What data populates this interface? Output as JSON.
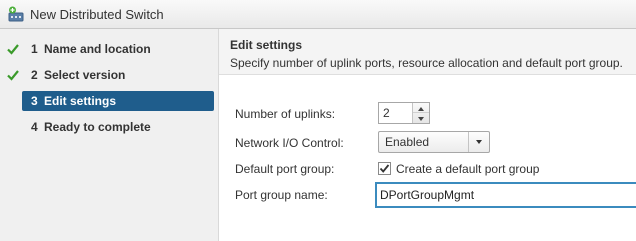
{
  "window": {
    "title": "New Distributed Switch",
    "icon": "distributed-switch-add-icon"
  },
  "sidebar": {
    "steps": [
      {
        "number": "1",
        "label": "Name and location",
        "status": "completed"
      },
      {
        "number": "2",
        "label": "Select version",
        "status": "completed"
      },
      {
        "number": "3",
        "label": "Edit settings",
        "status": "active"
      },
      {
        "number": "4",
        "label": "Ready to complete",
        "status": "pending"
      }
    ]
  },
  "header": {
    "title": "Edit settings",
    "description": "Specify number of uplink ports, resource allocation and default port group."
  },
  "form": {
    "uplinks_label": "Number of uplinks:",
    "uplinks_value": "2",
    "nioc_label": "Network I/O Control:",
    "nioc_value": "Enabled",
    "default_pg_label": "Default port group:",
    "create_default_label": "Create a default port group",
    "create_default_checked": true,
    "pg_name_label": "Port group name:",
    "pg_name_value": "DPortGroupMgmt"
  },
  "colors": {
    "active_step": "#1f5d8c",
    "check_green": "#3a9a2a",
    "focus_border": "#3b8bbe"
  }
}
